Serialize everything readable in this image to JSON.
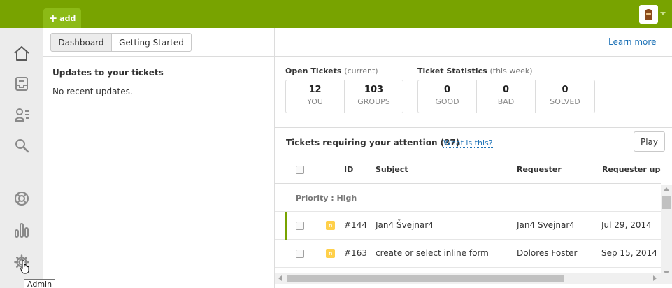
{
  "topbar": {
    "add_label": "add",
    "add_icon": "plus-icon",
    "brand_color": "#78a300"
  },
  "sidebar": {
    "items": [
      {
        "icon": "home-icon"
      },
      {
        "icon": "inbox-icon"
      },
      {
        "icon": "contacts-icon"
      },
      {
        "icon": "search-icon"
      },
      {
        "icon": "support-lifebuoy-icon"
      },
      {
        "icon": "reporting-chart-icon"
      },
      {
        "icon": "admin-gear-icon"
      }
    ],
    "tooltip": "Admin"
  },
  "left_pane": {
    "tabs": [
      {
        "label": "Dashboard",
        "active": true
      },
      {
        "label": "Getting Started",
        "active": false
      }
    ],
    "updates_title": "Updates to your tickets",
    "updates_empty": "No recent updates."
  },
  "right_pane": {
    "learn_more": "Learn more",
    "open_tickets": {
      "title": "Open Tickets",
      "subtitle": "(current)",
      "cells": [
        {
          "value": "12",
          "label": "YOU"
        },
        {
          "value": "103",
          "label": "GROUPS"
        }
      ]
    },
    "ticket_statistics": {
      "title": "Ticket Statistics",
      "subtitle": "(this week)",
      "cells": [
        {
          "value": "0",
          "label": "GOOD"
        },
        {
          "value": "0",
          "label": "BAD"
        },
        {
          "value": "0",
          "label": "SOLVED"
        }
      ]
    },
    "tickets_title": "Tickets requiring your attention (37)",
    "what_is_this": "What is this?",
    "play_label": "Play",
    "table": {
      "columns": [
        "ID",
        "Subject",
        "Requester",
        "Requester updated"
      ],
      "group_label": "Priority : High",
      "rows": [
        {
          "status": "n",
          "id": "#144",
          "subject": "Jan4 Švejnar4",
          "requester": "Jan4 Svejnar4",
          "updated": "Jul 29, 2014"
        },
        {
          "status": "n",
          "id": "#163",
          "subject": "create or select inline form",
          "requester": "Dolores Foster",
          "updated": "Sep 15, 2014"
        }
      ]
    }
  }
}
